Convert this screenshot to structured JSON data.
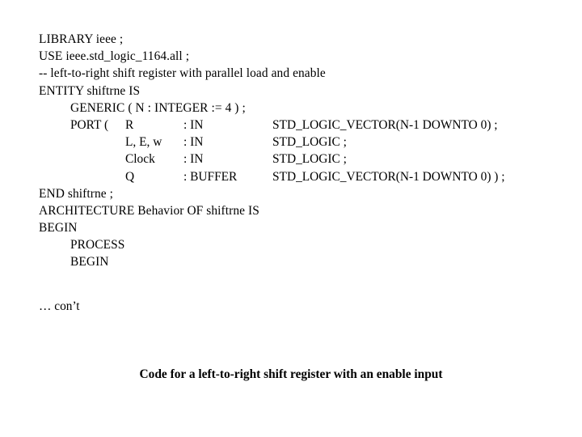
{
  "slide": {
    "background_color": "#ffffff",
    "text_color": "#000000",
    "code": {
      "line_1": "LIBRARY ieee ;",
      "line_2": "USE ieee.std_logic_1164.all ;",
      "line_3": "-- left-to-right shift register with parallel load and enable",
      "line_4": "ENTITY shiftrne IS",
      "line_5": "GENERIC ( N : INTEGER := 4 ) ;",
      "ports": {
        "keyword": "PORT (",
        "rows": [
          {
            "name": "R",
            "dir": ": IN",
            "type": "STD_LOGIC_VECTOR(N-1 DOWNTO 0) ;"
          },
          {
            "name": "L, E, w",
            "dir": ": IN",
            "type": "STD_LOGIC ;"
          },
          {
            "name": "Clock",
            "dir": ": IN",
            "type": "STD_LOGIC ;"
          },
          {
            "name": "Q",
            "dir": ": BUFFER",
            "type": "STD_LOGIC_VECTOR(N-1 DOWNTO 0) ) ;"
          }
        ]
      },
      "line_10": "END shiftrne ;",
      "line_11": "ARCHITECTURE Behavior OF shiftrne IS",
      "line_12": "BEGIN",
      "line_13": "PROCESS",
      "line_14": "BEGIN"
    },
    "continuation_note": "… con’t",
    "caption": "Code for a left-to-right shift register with an enable input"
  }
}
